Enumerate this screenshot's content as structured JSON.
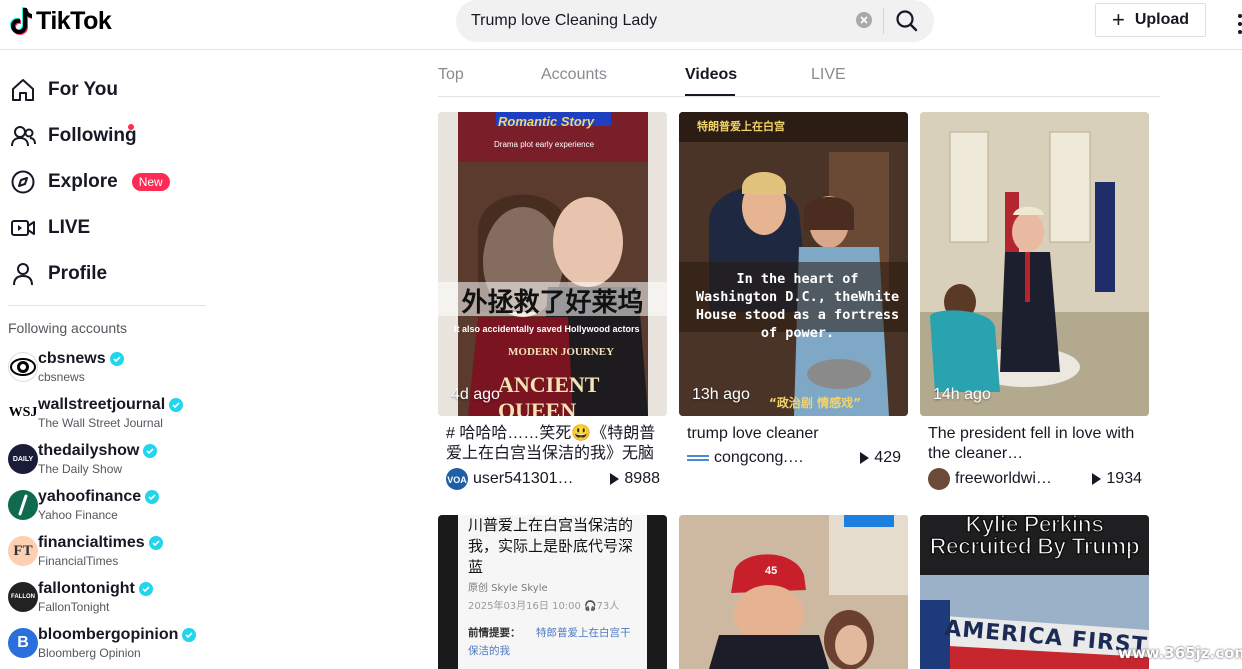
{
  "header": {
    "logo_text": "TikTok",
    "search_value": "Trump love Cleaning Lady",
    "upload_label": "Upload"
  },
  "sidebar": {
    "nav": [
      {
        "label": "For You",
        "icon": "home-icon"
      },
      {
        "label": "Following",
        "icon": "following-icon"
      },
      {
        "label": "Explore",
        "icon": "compass-icon",
        "badge": "New"
      },
      {
        "label": "LIVE",
        "icon": "live-icon"
      },
      {
        "label": "Profile",
        "icon": "profile-icon"
      }
    ],
    "following_title": "Following accounts",
    "accounts": [
      {
        "name": "cbsnews",
        "sub": "cbsnews"
      },
      {
        "name": "wallstreetjournal",
        "sub": "The Wall Street Journal"
      },
      {
        "name": "thedailyshow",
        "sub": "The Daily Show"
      },
      {
        "name": "yahoofinance",
        "sub": "Yahoo Finance"
      },
      {
        "name": "financialtimes",
        "sub": "FinancialTimes"
      },
      {
        "name": "fallontonight",
        "sub": "FallonTonight"
      },
      {
        "name": "bloombergopinion",
        "sub": "Bloomberg Opinion"
      }
    ]
  },
  "tabs": [
    "Top",
    "Accounts",
    "Videos",
    "LIVE"
  ],
  "active_tab": "Videos",
  "videos": [
    {
      "time": "4d ago",
      "desc": "# 哈哈哈……笑死😃《特朗普爱上在白宫当保洁的我》无脑短…",
      "user": "user541301…",
      "plays": "8988",
      "thumb_top": "Romantic Story",
      "thumb_top2": "Drama plot early experience",
      "thumb_mid": "外拯救了好莱坞",
      "thumb_sub": "It also accidentally saved Hollywood actors",
      "thumb_bottom": "MODERN JOURNEY",
      "thumb_bottom2": "ANCIENT QUEEN"
    },
    {
      "time": "13h ago",
      "desc": "trump love cleaner",
      "user": "congcong.…",
      "plays": "429",
      "thumb_top": "特朗普爱上在白宫",
      "thumb_mid": "In the heart of Washington D.C., theWhite House stood as a fortress of power.",
      "thumb_bottom": "“政治剧 情感戏”"
    },
    {
      "time": "14h ago",
      "desc": "The president fell in love with the cleaner…",
      "user": "freeworldwi…",
      "plays": "1934"
    },
    {
      "text_lines": [
        "川普爱上在白宫当保洁的",
        "我，实际上是卧底代号深",
        "蓝"
      ],
      "meta_line": "原创  Skyle  Skyle",
      "date_line": "2025年03月16日  10:00  🎧73人",
      "footer_label": "前情提要：",
      "footer_text": "特郎普爱上在白宫干",
      "footer_text2": "保洁的我"
    },
    {
      "cap_text": "45"
    },
    {
      "title1": "Kylie Perkins",
      "title2": "Recruited By Trump",
      "sign": "AMERICA FIRST"
    }
  ],
  "watermark": "www.365jz.com",
  "colors": {
    "accent": "#fe2c55",
    "verified": "#20d5ec",
    "text": "#161823",
    "muted": "#8a8b91"
  }
}
